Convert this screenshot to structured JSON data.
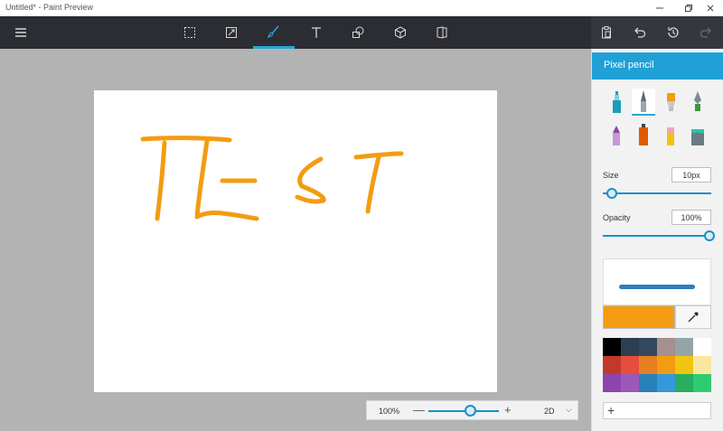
{
  "window": {
    "title": "Untitled* - Paint Preview",
    "controls": [
      "minimize",
      "maximize",
      "close"
    ]
  },
  "toolbar": {
    "menu_icon": "hamburger-icon",
    "tools": [
      {
        "name": "select",
        "icon": "select-icon"
      },
      {
        "name": "crop",
        "icon": "crop-icon"
      },
      {
        "name": "brushes",
        "icon": "brush-icon",
        "active": true
      },
      {
        "name": "text",
        "icon": "text-icon"
      },
      {
        "name": "2d-shapes",
        "icon": "shapes-icon"
      },
      {
        "name": "3d-objects",
        "icon": "cube-icon"
      },
      {
        "name": "canvas",
        "icon": "canvas-icon"
      }
    ],
    "right_icons": [
      "paste-icon",
      "undo-icon",
      "history-icon",
      "redo-icon"
    ]
  },
  "canvas": {
    "drawing_text": "TEST",
    "stroke_color": "#f39c12"
  },
  "zoom": {
    "value": "100%",
    "minus": "—",
    "plus": "+",
    "level": 0.6,
    "mode": "2D",
    "chevron": "⌵"
  },
  "panel": {
    "title": "Pixel pencil",
    "size_label": "Size",
    "size_value": "10px",
    "size_level": 0.08,
    "opacity_label": "Opacity",
    "opacity_value": "100%",
    "opacity_level": 1.0,
    "current_color": "#f39c12",
    "add_label": "+",
    "palette": [
      "#000000",
      "#2d3e50",
      "#34495e",
      "#a68f8f",
      "#95a5a6",
      "#ffffff",
      "#c0392b",
      "#e74c3c",
      "#e67e22",
      "#f39c12",
      "#f1c40f",
      "#f9e79f",
      "#8e44ad",
      "#9b59b6",
      "#2980b9",
      "#3498db",
      "#27ae60",
      "#2ecc71"
    ]
  },
  "colors": {
    "accent": "#1fa1d7",
    "toolbar_bg": "#2b2d33"
  }
}
